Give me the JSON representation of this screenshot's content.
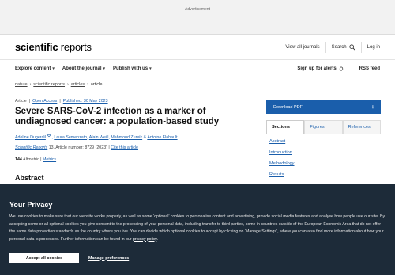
{
  "ad": {
    "label": "Advertisement"
  },
  "masthead": {
    "logo_bold": "scientific",
    "logo_regular": "reports",
    "view_all_journals": "View all journals",
    "search": "Search",
    "login": "Log in"
  },
  "nav": {
    "explore": "Explore content",
    "about": "About the journal",
    "publish": "Publish with us",
    "alerts": "Sign up for alerts",
    "rss": "RSS feed"
  },
  "breadcrumb": [
    "nature",
    "scientific reports",
    "articles",
    "article"
  ],
  "article": {
    "type": "Article",
    "access": "Open Access",
    "published": "Published: 30 May 2023",
    "title": "Severe SARS-CoV-2 infection as a marker of undiagnosed cancer: a population-based study",
    "authors": [
      "Adeline Dugerdil",
      "Laura Semenzato",
      "Alain Weill",
      "Mahmoud Zureik",
      "Antoine Flahault"
    ],
    "journal": "Scientific Reports",
    "journal_detail": "13, Article number: 8729 (2023)",
    "cite": "Cite this article",
    "altmetric_count": "144",
    "altmetric_label": "Altmetric",
    "metrics": "Metrics",
    "abstract_heading": "Abstract"
  },
  "sidebar": {
    "download": "Download PDF",
    "tabs": [
      "Sections",
      "Figures",
      "References"
    ],
    "sections": [
      "Abstract",
      "Introduction",
      "Methodology",
      "Results"
    ]
  },
  "cookie": {
    "title": "Your Privacy",
    "text": "We use cookies to make sure that our website works properly, as well as some ‘optional’ cookies to personalise content and advertising, provide social media features and analyse how people use our site. By accepting some or all optional cookies you give consent to the processing of your personal data, including transfer to third parties, some in countries outside of the European Economic Area that do not offer the same data protection standards as the country where you live. You can decide which optional cookies to accept by clicking on ‘Manage Settings’, where you can also find more information about how your personal data is processed. Further information can be found in our ",
    "privacy_link": "privacy policy",
    "text_end": ".",
    "accept": "Accept all cookies",
    "manage": "Manage preferences"
  },
  "colors": {
    "accent": "#1a5eab",
    "banner": "#1d2b39"
  }
}
